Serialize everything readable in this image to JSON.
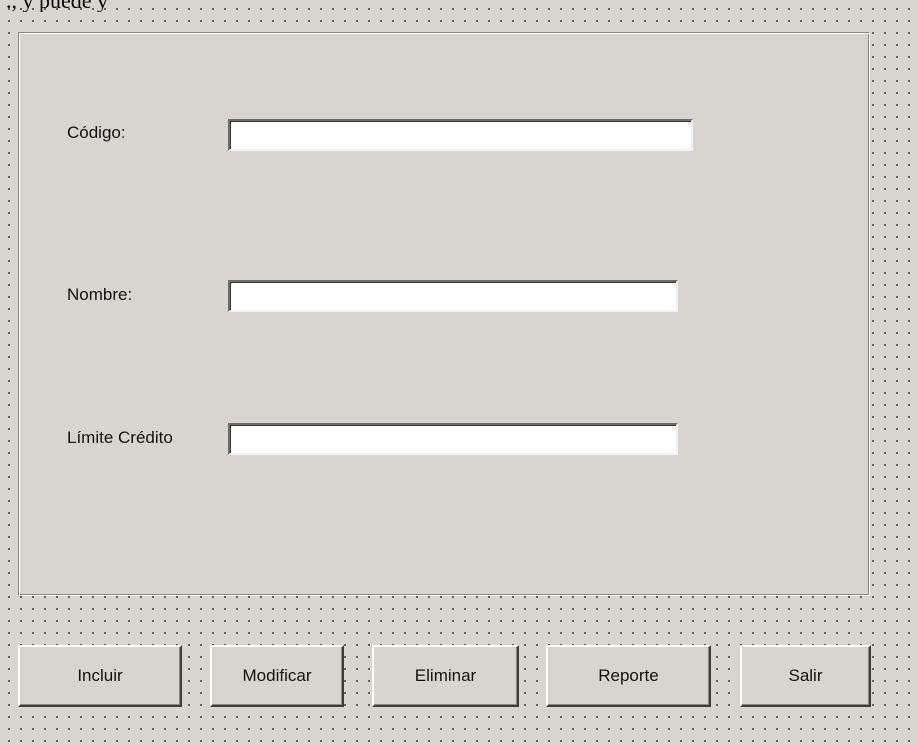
{
  "header": {
    "fragment_text": "., y puede y"
  },
  "form": {
    "fields": [
      {
        "label": "Código:",
        "value": ""
      },
      {
        "label": "Nombre:",
        "value": ""
      },
      {
        "label": "Límite Crédito",
        "value": ""
      }
    ]
  },
  "buttons": {
    "incluir": "Incluir",
    "modificar": "Modificar",
    "eliminar": "Eliminar",
    "reporte": "Reporte",
    "salir": "Salir"
  },
  "colors": {
    "face": "#d8d5d0",
    "field_bg": "#ffffff",
    "grid_dot": "#4a4a4a"
  }
}
